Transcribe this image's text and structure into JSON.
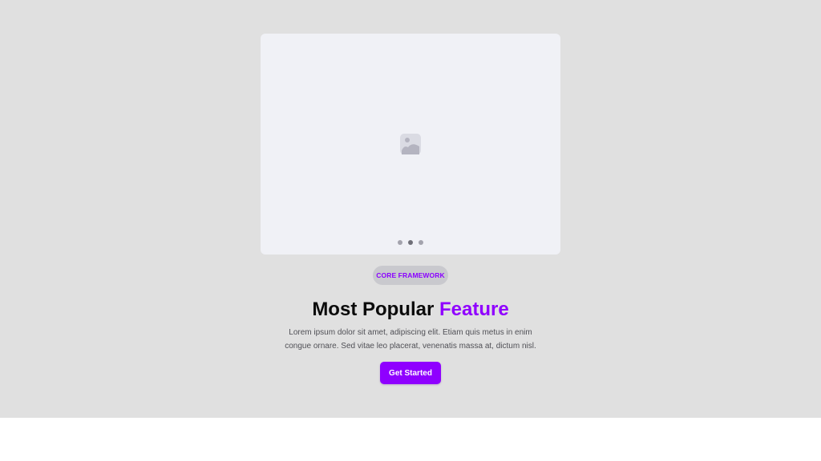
{
  "hero": {
    "carousel": {
      "placeholder_icon": "image-placeholder-icon",
      "slide_count": 3,
      "active_slide": 2
    },
    "badge": "CORE FRAMEWORK",
    "title_main": "Most Popular ",
    "title_accent": "Feature",
    "description_line1": "Lorem ipsum dolor sit amet, adipiscing elit. Etiam quis metus in enim",
    "description_line2": "congue ornare. Sed vitae leo placerat, venenatis massa at, dictum nisl.",
    "cta_label": "Get Started"
  },
  "colors": {
    "background": "#e0e0e0",
    "accent": "#9000ff",
    "card": "#f0f1f6"
  }
}
